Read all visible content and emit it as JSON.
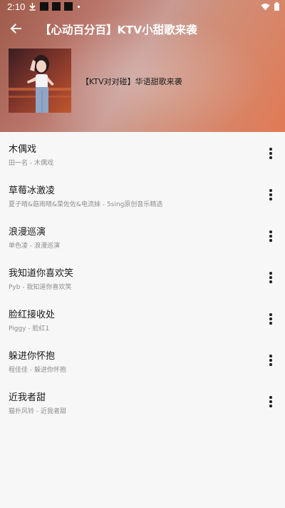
{
  "status_bar": {
    "time": "2:10"
  },
  "toolbar": {
    "title": "【心动百分百】KTV小甜歌来袭",
    "back_icon": "arrow-left-icon"
  },
  "playlist": {
    "name": "【KTV对对碰】华语甜歌来袭"
  },
  "songs": [
    {
      "title": "木偶戏",
      "subtitle": "田一名 - 木偶戏"
    },
    {
      "title": "草莓冰激凌",
      "subtitle": "夏子晴&菇雨晴&菜佐佐&电流妹 - 5sing原创音乐精选"
    },
    {
      "title": "浪漫巡演",
      "subtitle": "单色凌 - 浪漫巡演"
    },
    {
      "title": "我知道你喜欢笑",
      "subtitle": "Pyb - 我知道你喜欢笑"
    },
    {
      "title": "脸红接收处",
      "subtitle": "Piggy - 脸红1"
    },
    {
      "title": "躲进你怀抱",
      "subtitle": "程佳佳 - 躲进你怀抱"
    },
    {
      "title": "近我者甜",
      "subtitle": "猫扑风铃 - 近我者甜"
    }
  ],
  "colors": {
    "header_start": "#9e5b4a",
    "header_end": "#e07a55",
    "list_bg": "#f7f7f7"
  }
}
